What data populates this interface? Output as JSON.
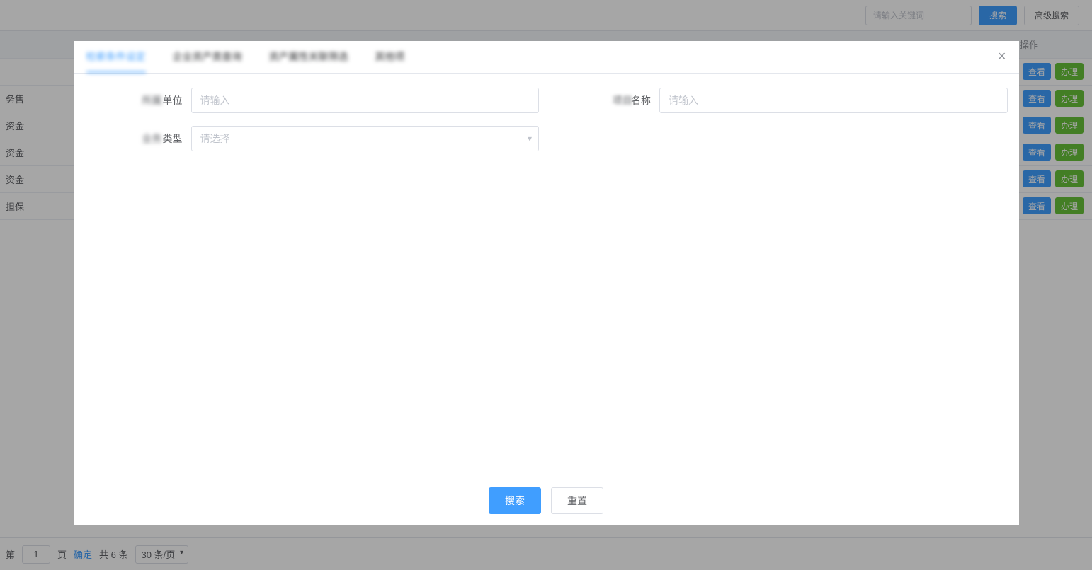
{
  "topbar": {
    "search_placeholder": "请输入关键词",
    "search_btn": "搜索",
    "advanced_btn": "高级搜索"
  },
  "table": {
    "ops_header": "操作",
    "view_label": "查看",
    "handle_label": "办理",
    "rows": [
      {
        "col0": ""
      },
      {
        "col0": "务售"
      },
      {
        "col0": "资金"
      },
      {
        "col0": "资金"
      },
      {
        "col0": "资金"
      },
      {
        "col0": "担保"
      }
    ]
  },
  "pager": {
    "prefix": "第",
    "page": "1",
    "suffix": "页",
    "confirm": "确定",
    "total": "共 6 条",
    "page_size": "30 条/页"
  },
  "modal": {
    "tabs": [
      "检索条件设定",
      "企业资产类查询",
      "资产属性关联筛选",
      "其他项"
    ],
    "active_tab_index": 0,
    "fields": {
      "unit_label_blur": "所属",
      "unit_label": "单位",
      "unit_placeholder": "请输入",
      "name_label_blur": "项目",
      "name_label": "名称",
      "name_placeholder": "请输入",
      "type_label_blur": "业务",
      "type_label": "类型",
      "type_placeholder": "请选择"
    },
    "footer": {
      "search": "搜索",
      "reset": "重置"
    }
  }
}
